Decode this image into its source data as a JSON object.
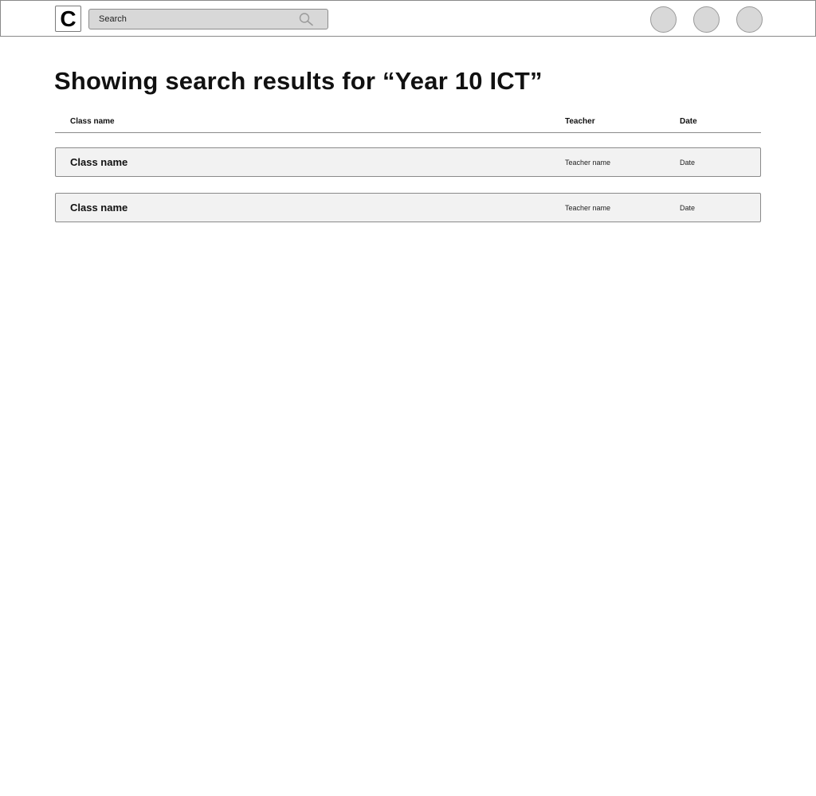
{
  "header": {
    "logo_letter": "C",
    "search": {
      "placeholder": "Search",
      "value": ""
    },
    "icons": [
      "avatar-circle",
      "avatar-circle",
      "avatar-circle"
    ]
  },
  "main": {
    "heading": "Showing search results for “Year 10 ICT”",
    "columns": {
      "class_name": "Class name",
      "teacher": "Teacher",
      "date": "Date"
    },
    "results": [
      {
        "class_name": "Class name",
        "teacher": "Teacher name",
        "date": "Date"
      },
      {
        "class_name": "Class name",
        "teacher": "Teacher name",
        "date": "Date"
      }
    ]
  },
  "colors": {
    "search_bg": "#d8d8d8",
    "row_bg": "#f2f2f2",
    "border": "#8a8a8a"
  }
}
